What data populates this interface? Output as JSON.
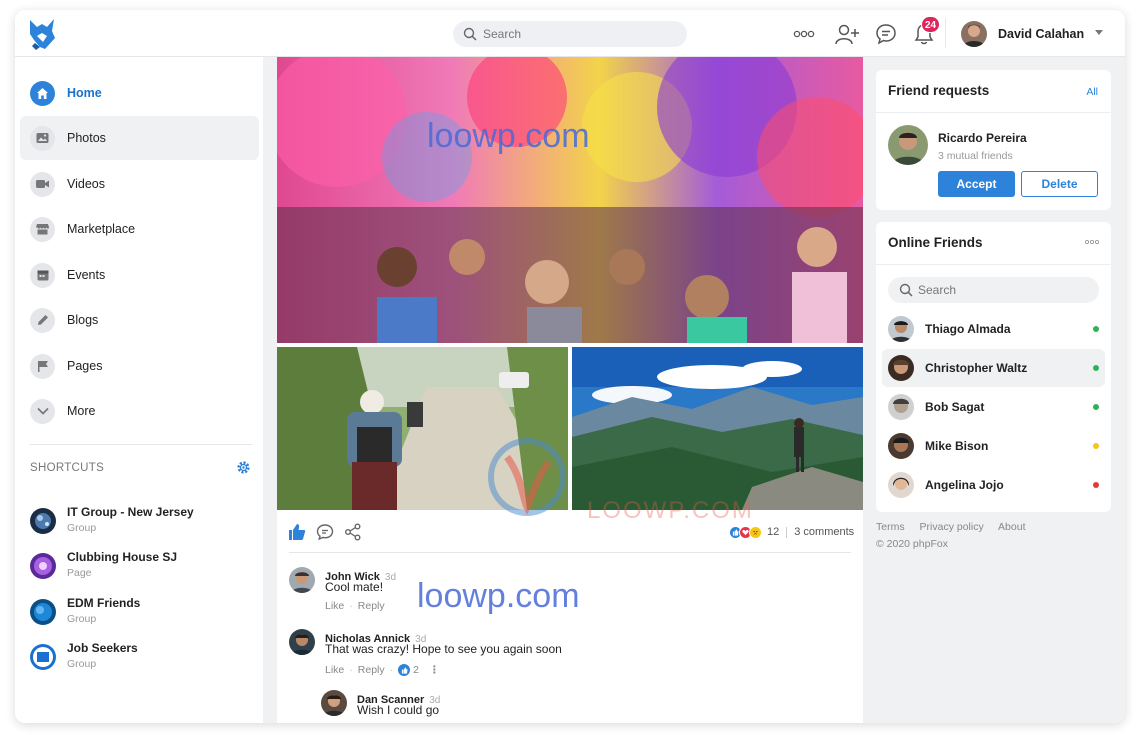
{
  "topbar": {
    "search_placeholder": "Search",
    "notification_count": "24",
    "user_name": "David Calahan"
  },
  "sidebar": {
    "nav": [
      {
        "label": "Home",
        "icon": "home-icon"
      },
      {
        "label": "Photos",
        "icon": "photo-icon"
      },
      {
        "label": "Videos",
        "icon": "video-icon"
      },
      {
        "label": "Marketplace",
        "icon": "shop-icon"
      },
      {
        "label": "Events",
        "icon": "calendar-icon"
      },
      {
        "label": "Blogs",
        "icon": "pencil-icon"
      },
      {
        "label": "Pages",
        "icon": "flag-icon"
      },
      {
        "label": "More",
        "icon": "chevron-down-icon"
      }
    ],
    "shortcuts_title": "SHORTCUTS",
    "shortcuts": [
      {
        "name": "IT Group - New Jersey",
        "type": "Group"
      },
      {
        "name": "Clubbing House SJ",
        "type": "Page"
      },
      {
        "name": "EDM Friends",
        "type": "Group"
      },
      {
        "name": "Job Seekers",
        "type": "Group"
      }
    ]
  },
  "post": {
    "watermark_top": "loowp.com",
    "watermark_bottom": "LOOWP.COM",
    "watermark_comments": "loowp.com",
    "reaction_count": "12",
    "comments_count": "3 comments",
    "comments": [
      {
        "name": "John Wick",
        "time": "3d",
        "text": "Cool mate!",
        "like": "Like",
        "reply": "Reply"
      },
      {
        "name": "Nicholas Annick",
        "time": "3d",
        "text": "That was crazy! Hope to see you again soon",
        "like": "Like",
        "reply": "Reply",
        "likes": "2"
      },
      {
        "name": "Dan Scanner",
        "time": "3d",
        "text": "Wish I could go"
      }
    ]
  },
  "friend_requests": {
    "title": "Friend requests",
    "all_link": "All",
    "name": "Ricardo Pereira",
    "mutual": "3 mutual friends",
    "accept": "Accept",
    "delete": "Delete"
  },
  "online_friends": {
    "title": "Online Friends",
    "search_placeholder": "Search",
    "friends": [
      {
        "name": "Thiago Almada",
        "status": "#2bb35a"
      },
      {
        "name": "Christopher Waltz",
        "status": "#2bb35a"
      },
      {
        "name": "Bob Sagat",
        "status": "#2bb35a"
      },
      {
        "name": "Mike Bison",
        "status": "#f5c518"
      },
      {
        "name": "Angelina Jojo",
        "status": "#e53935"
      }
    ]
  },
  "footer": {
    "terms": "Terms",
    "privacy": "Privacy policy",
    "about": "About",
    "copyright": "© 2020 phpFox"
  },
  "colors": {
    "accent": "#2d83d9",
    "badge": "#e0245e"
  }
}
